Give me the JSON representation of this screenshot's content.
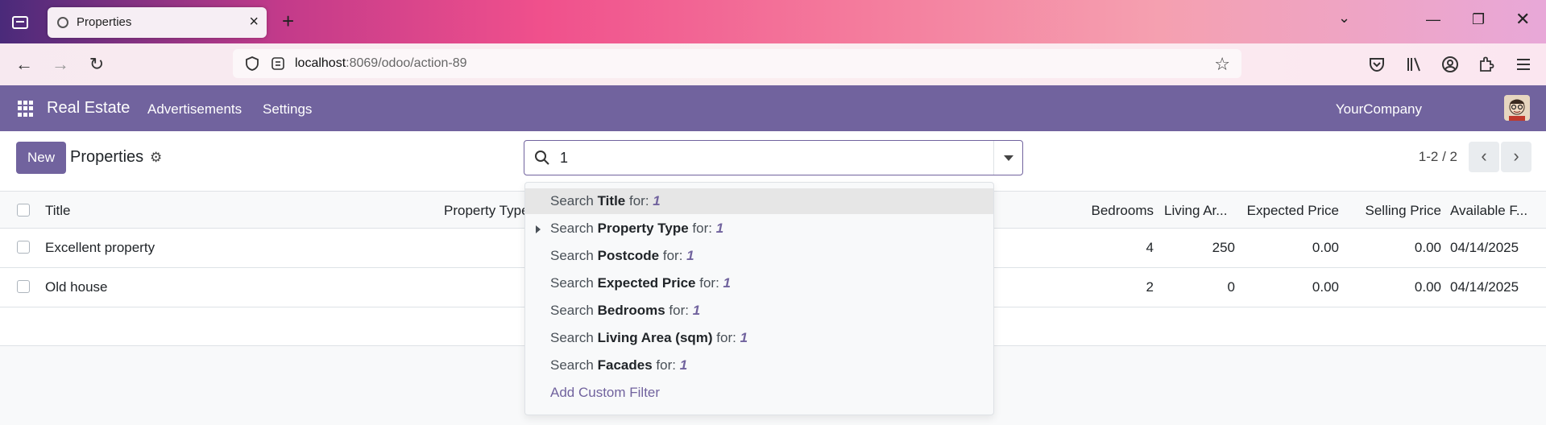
{
  "browser": {
    "tab_title": "Properties",
    "url_host": "localhost",
    "url_rest": ":8069/odoo/action-89"
  },
  "odoo_nav": {
    "brand": "Real Estate",
    "menus": [
      "Advertisements",
      "Settings"
    ],
    "company": "YourCompany"
  },
  "control_panel": {
    "new_label": "New",
    "breadcrumb": "Properties",
    "search_value": "1",
    "pager": "1-2 / 2"
  },
  "list": {
    "columns": [
      "Title",
      "Property Type",
      "Bedrooms",
      "Living Ar...",
      "Expected Price",
      "Selling Price",
      "Available F..."
    ],
    "rows": [
      {
        "title": "Excellent property",
        "bedrooms": "4",
        "living_area": "250",
        "expected_price": "0.00",
        "selling_price": "0.00",
        "available_from": "04/14/2025"
      },
      {
        "title": "Old house",
        "bedrooms": "2",
        "living_area": "0",
        "expected_price": "0.00",
        "selling_price": "0.00",
        "available_from": "04/14/2025"
      }
    ]
  },
  "search_dropdown": {
    "prefix": "Search",
    "suffix": "for:",
    "term": "1",
    "fields": [
      "Title",
      "Property Type",
      "Postcode",
      "Expected Price",
      "Bedrooms",
      "Living Area (sqm)",
      "Facades"
    ],
    "add_custom_filter": "Add Custom Filter"
  }
}
